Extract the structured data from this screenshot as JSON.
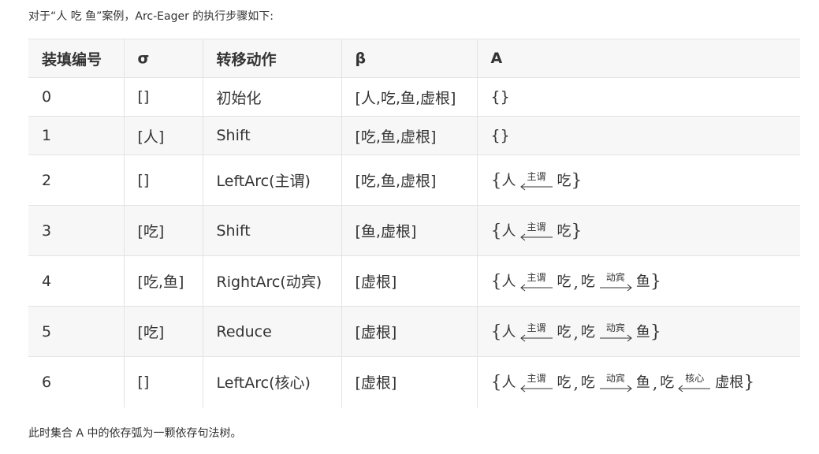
{
  "intro_text": "对于“人 吃 鱼”案例，Arc-Eager 的执行步骤如下:",
  "outro_text": "此时集合 A 中的依存弧为一颗依存句法树。",
  "table": {
    "headers": {
      "step": "装填编号",
      "sigma": "σ",
      "action": "转移动作",
      "beta": "β",
      "a": "A"
    },
    "rows": [
      {
        "step": "0",
        "sigma": "[]",
        "action": "初始化",
        "beta": "[人,吃,鱼,虚根]",
        "a_text": "{}"
      },
      {
        "step": "1",
        "sigma": "[人]",
        "action": "Shift",
        "beta": "[吃,鱼,虚根]",
        "a_text": "{}"
      },
      {
        "step": "2",
        "sigma": "[]",
        "action": "LeftArc(主谓)",
        "beta": "[吃,鱼,虚根]",
        "arcs": [
          {
            "from": "人",
            "label": "主谓",
            "dir": "left",
            "to": "吃"
          }
        ]
      },
      {
        "step": "3",
        "sigma": "[吃]",
        "action": "Shift",
        "beta": "[鱼,虚根]",
        "arcs": [
          {
            "from": "人",
            "label": "主谓",
            "dir": "left",
            "to": "吃"
          }
        ]
      },
      {
        "step": "4",
        "sigma": "[吃,鱼]",
        "action": "RightArc(动宾)",
        "beta": "[虚根]",
        "arcs": [
          {
            "from": "人",
            "label": "主谓",
            "dir": "left",
            "to": "吃"
          },
          {
            "from": "吃",
            "label": "动宾",
            "dir": "right",
            "to": "鱼"
          }
        ]
      },
      {
        "step": "5",
        "sigma": "[吃]",
        "action": "Reduce",
        "beta": "[虚根]",
        "arcs": [
          {
            "from": "人",
            "label": "主谓",
            "dir": "left",
            "to": "吃"
          },
          {
            "from": "吃",
            "label": "动宾",
            "dir": "right",
            "to": "鱼"
          }
        ]
      },
      {
        "step": "6",
        "sigma": "[]",
        "action": "LeftArc(核心)",
        "beta": "[虚根]",
        "arcs": [
          {
            "from": "人",
            "label": "主谓",
            "dir": "left",
            "to": "吃"
          },
          {
            "from": "吃",
            "label": "动宾",
            "dir": "right",
            "to": "鱼"
          },
          {
            "from": "吃",
            "label": "核心",
            "dir": "left",
            "to": "虚根"
          }
        ]
      }
    ]
  }
}
